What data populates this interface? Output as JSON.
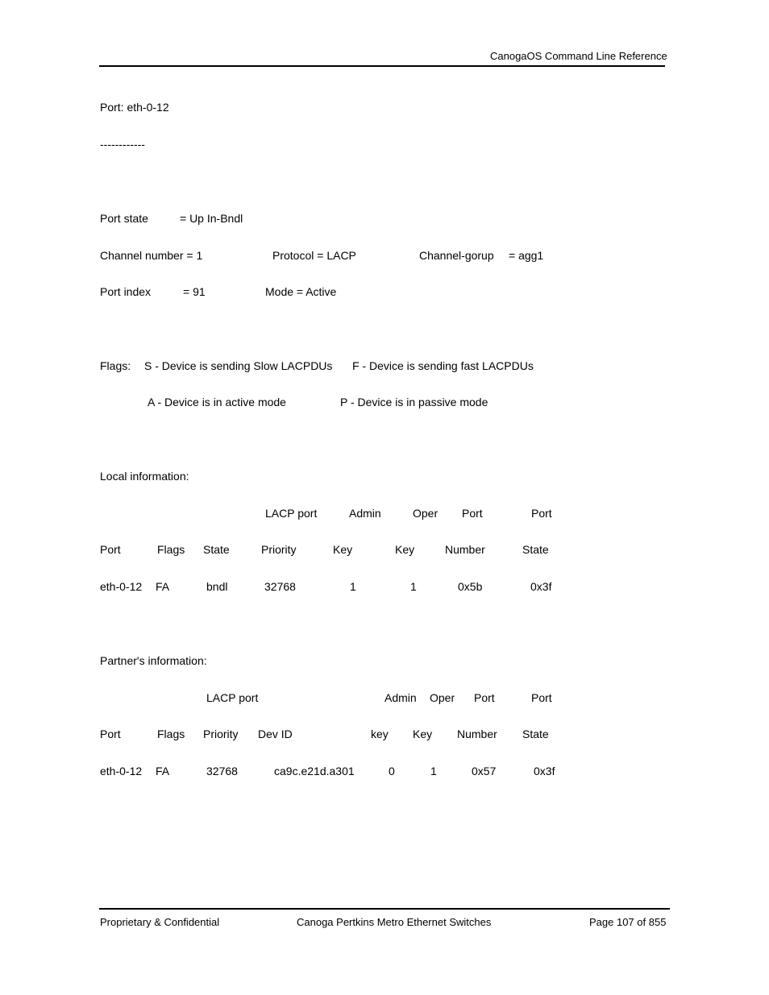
{
  "header": {
    "title": "CanogaOS Command Line Reference"
  },
  "body": {
    "port_line": "Port: eth-0-12",
    "separator": "------------",
    "port_state": {
      "label": "Port state",
      "value": "= Up In-Bndl"
    },
    "channel_number": "Channel number = 1",
    "protocol": "Protocol = LACP",
    "channel_group": {
      "label": "Channel-gorup",
      "value": "= agg1"
    },
    "port_index": {
      "label": "Port index",
      "value": "= 91"
    },
    "mode": "Mode = Active",
    "flags": {
      "label": "Flags:",
      "s": "S - Device is sending Slow LACPDUs",
      "f": "F - Device is sending fast LACPDUs",
      "a": "A - Device is in active mode",
      "p": "P - Device is in passive mode"
    },
    "local": {
      "title": "Local information:",
      "header_top": [
        "",
        "",
        "",
        "LACP port",
        "Admin",
        "Oper",
        "Port",
        "Port"
      ],
      "header_bottom": [
        "Port",
        "Flags",
        "State",
        "Priority",
        "Key",
        "Key",
        "Number",
        "State"
      ],
      "rows": [
        [
          "eth-0-12",
          "FA",
          "bndl",
          "32768",
          "1",
          "1",
          "0x5b",
          "0x3f"
        ]
      ]
    },
    "partner": {
      "title": "Partner's information:",
      "header_top": [
        "",
        "",
        "LACP port",
        "",
        "Admin",
        "Oper",
        "Port",
        "Port"
      ],
      "header_bottom": [
        "Port",
        "Flags",
        "Priority",
        "Dev ID",
        "key",
        "Key",
        "Number",
        "State"
      ],
      "rows": [
        [
          "eth-0-12",
          "FA",
          "32768",
          "ca9c.e21d.a301",
          "0",
          "1",
          "0x57",
          "0x3f"
        ]
      ]
    }
  },
  "footer": {
    "left": "Proprietary & Confidential",
    "center": "Canoga Pertkins Metro Ethernet Switches",
    "right": "Page 107 of 855"
  }
}
